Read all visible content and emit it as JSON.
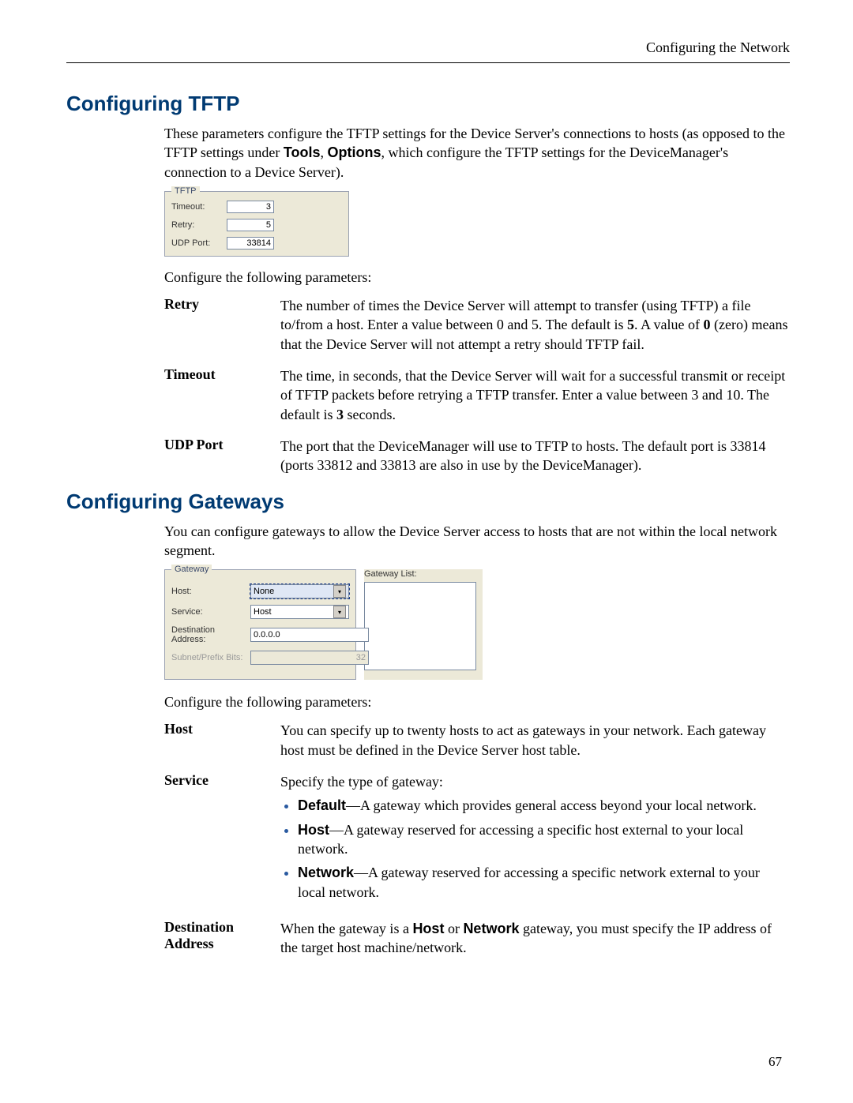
{
  "header": {
    "running": "Configuring the Network"
  },
  "page_number": "67",
  "tftp_section": {
    "heading": "Configuring TFTP",
    "intro_pre": "These parameters configure the TFTP settings for the Device Server's connections to hosts (as opposed to the TFTP settings under ",
    "intro_bold1": "Tools",
    "intro_mid": ", ",
    "intro_bold2": "Options",
    "intro_post": ", which configure the TFTP settings for the DeviceManager's connection to a Device Server).",
    "panel": {
      "legend": "TFTP",
      "rows": [
        {
          "label": "Timeout:",
          "value": "3"
        },
        {
          "label": "Retry:",
          "value": "5"
        },
        {
          "label": "UDP Port:",
          "value": "33814"
        }
      ]
    },
    "configure_line": "Configure the following parameters:",
    "params": [
      {
        "term": "Retry",
        "desc_pre": "The number of times the Device Server will attempt to transfer (using TFTP) a file to/from a host. Enter a value between 0 and 5. The default is ",
        "desc_b1": "5",
        "desc_mid": ". A value of ",
        "desc_b2": "0",
        "desc_post": " (zero) means that the Device Server will not attempt a retry should TFTP fail."
      },
      {
        "term": "Timeout",
        "desc_pre": "The time, in seconds, that the Device Server will wait for a successful transmit or receipt of TFTP packets before retrying a TFTP transfer. Enter a value between 3 and 10. The default is ",
        "desc_b1": "3",
        "desc_post": " seconds."
      },
      {
        "term": "UDP Port",
        "desc_pre": "The port that the DeviceManager will use to TFTP to hosts. The default port is 33814 (ports 33812 and 33813 are also in use by the DeviceManager)."
      }
    ]
  },
  "gw_section": {
    "heading": "Configuring Gateways",
    "intro": "You can configure gateways to allow the Device Server access to hosts that are not within the local network segment.",
    "panel": {
      "legend": "Gateway",
      "list_label": "Gateway List:",
      "rows": [
        {
          "label": "Host:",
          "value": "None",
          "type": "select",
          "highlight": true
        },
        {
          "label": "Service:",
          "value": "Host",
          "type": "select"
        },
        {
          "label": "Destination Address:",
          "value": "0.0.0.0",
          "type": "input"
        },
        {
          "label": "Subnet/Prefix Bits:",
          "value": "32",
          "type": "input",
          "disabled": true
        }
      ]
    },
    "configure_line": "Configure the following parameters:",
    "params": {
      "host": {
        "term": "Host",
        "desc": "You can specify up to twenty hosts to act as gateways in your network. Each gateway host must be defined in the Device Server host table."
      },
      "service": {
        "term": "Service",
        "lead": "Specify the type of gateway:",
        "bullets": [
          {
            "b": "Default",
            "t": "—A gateway which provides general access beyond your local network."
          },
          {
            "b": "Host",
            "t": "—A gateway reserved for accessing a specific host external to your local network."
          },
          {
            "b": "Network",
            "t": "—A gateway reserved for accessing a specific network external to your local network."
          }
        ]
      },
      "dest": {
        "term": "Destination Address",
        "desc_pre": "When the gateway is a ",
        "b1": "Host",
        "mid": " or ",
        "b2": "Network",
        "desc_post": " gateway, you must specify the IP address of the target host machine/network."
      }
    }
  }
}
